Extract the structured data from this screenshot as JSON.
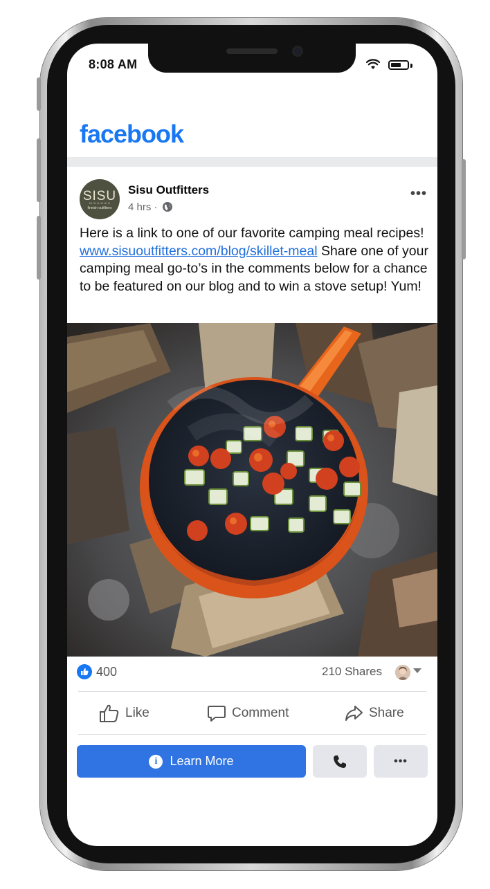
{
  "status_bar": {
    "time": "8:08 AM"
  },
  "header": {
    "logo_text": "facebook"
  },
  "post": {
    "page_name": "Sisu Outfitters",
    "avatar_text": "SISU",
    "avatar_subtext": "finnish outfitters",
    "timestamp": "4 hrs",
    "separator": "·",
    "text_before_link": "Here is a link to one of our favorite camping meal recipes! ",
    "link": "www.sisuoutfitters.com/blog/skillet-meal",
    "text_after_link": "Share one of your camping meal go-to’s in the comments below for a chance to be featured on our blog and to win a stove setup! Yum!",
    "image_icon": "campfire-skillet-photo"
  },
  "engagement": {
    "likes": "400",
    "shares": "210 Shares"
  },
  "actions": {
    "like": "Like",
    "comment": "Comment",
    "share": "Share"
  },
  "cta": {
    "learn_more": "Learn More",
    "call_icon": "phone-icon",
    "more": "•••"
  },
  "colors": {
    "brand": "#1877f2",
    "cta": "#2f74e2",
    "link": "#216fdb"
  }
}
